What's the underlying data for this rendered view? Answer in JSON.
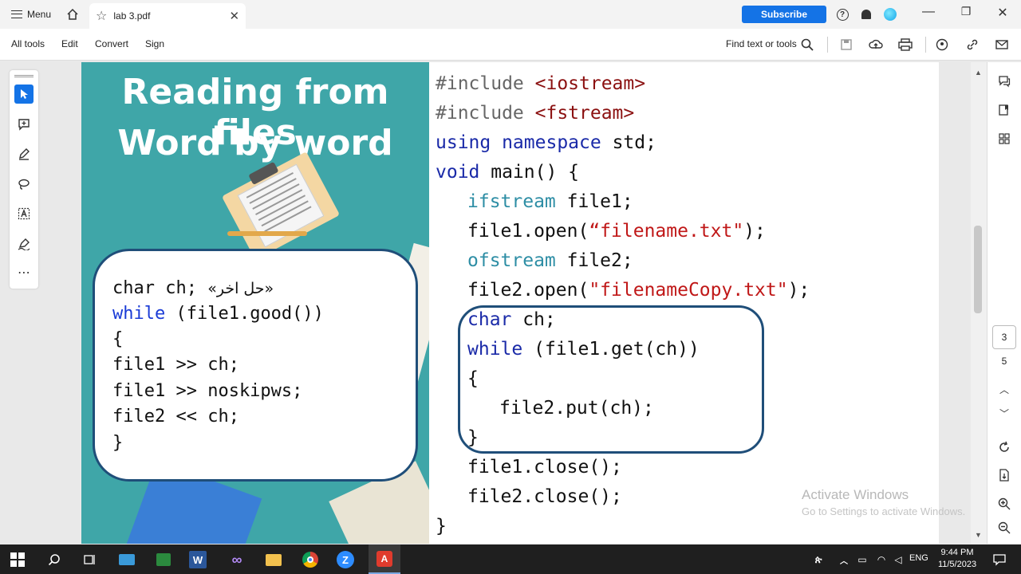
{
  "titlebar": {
    "menu_label": "Menu",
    "tab_name": "lab 3.pdf",
    "subscribe_label": "Subscribe"
  },
  "toolbar": {
    "items": [
      "All tools",
      "Edit",
      "Convert",
      "Sign"
    ],
    "find_label": "Find text or tools"
  },
  "slide": {
    "title_line1": "Reading from files",
    "title_line2": "Word by word",
    "left_code": [
      {
        "kw": "",
        "text": "char ch; ",
        "arabic": "«حل اخر»"
      },
      {
        "kw": "while",
        "text": " (file1.good())"
      },
      {
        "kw": "",
        "text": "{"
      },
      {
        "kw": "",
        "text": "file1 >> ch;"
      },
      {
        "kw": "",
        "text": "file1 >> noskipws;"
      },
      {
        "kw": "",
        "text": "file2 << ch;"
      },
      {
        "kw": "",
        "text": "}"
      }
    ],
    "right_code": [
      {
        "indent": 0,
        "parts": [
          {
            "c": "gray",
            "t": "#include "
          },
          {
            "c": "maroon",
            "t": "<iostream>"
          }
        ]
      },
      {
        "indent": 0,
        "parts": [
          {
            "c": "gray",
            "t": "#include "
          },
          {
            "c": "maroon",
            "t": "<fstream>"
          }
        ]
      },
      {
        "indent": 0,
        "parts": [
          {
            "c": "navy",
            "t": "using namespace"
          },
          {
            "c": "",
            "t": " std;"
          }
        ]
      },
      {
        "indent": 0,
        "parts": [
          {
            "c": "navy",
            "t": "void"
          },
          {
            "c": "",
            "t": " main() {"
          }
        ]
      },
      {
        "indent": 1,
        "parts": [
          {
            "c": "teal",
            "t": "ifstream"
          },
          {
            "c": "",
            "t": " file1;"
          }
        ]
      },
      {
        "indent": 1,
        "parts": [
          {
            "c": "",
            "t": "file1.open("
          },
          {
            "c": "red",
            "t": "“filename.txt\""
          },
          {
            "c": "",
            "t": ");"
          }
        ]
      },
      {
        "indent": 1,
        "parts": [
          {
            "c": "teal",
            "t": "ofstream"
          },
          {
            "c": "",
            "t": " file2;"
          }
        ]
      },
      {
        "indent": 1,
        "parts": [
          {
            "c": "",
            "t": "file2.open("
          },
          {
            "c": "red",
            "t": "\"filenameCopy.txt\""
          },
          {
            "c": "",
            "t": ");"
          }
        ]
      },
      {
        "indent": 1,
        "parts": [
          {
            "c": "navy",
            "t": "char"
          },
          {
            "c": "",
            "t": " ch;"
          }
        ]
      },
      {
        "indent": 1,
        "parts": [
          {
            "c": "navy",
            "t": "while"
          },
          {
            "c": "",
            "t": " (file1.get(ch))"
          }
        ]
      },
      {
        "indent": 1,
        "parts": [
          {
            "c": "",
            "t": "{"
          }
        ]
      },
      {
        "indent": 2,
        "parts": [
          {
            "c": "",
            "t": "file2.put(ch);"
          }
        ]
      },
      {
        "indent": 1,
        "parts": [
          {
            "c": "",
            "t": "}"
          }
        ]
      },
      {
        "indent": 1,
        "parts": [
          {
            "c": "",
            "t": "file1.close();"
          }
        ]
      },
      {
        "indent": 1,
        "parts": [
          {
            "c": "",
            "t": "file2.close();"
          }
        ]
      },
      {
        "indent": 0,
        "parts": [
          {
            "c": "",
            "t": "}"
          }
        ]
      }
    ]
  },
  "navigation": {
    "current_page": "3",
    "total_pages": "5"
  },
  "watermark": {
    "line1": "Activate Windows",
    "line2": "Go to Settings to activate Windows."
  },
  "taskbar": {
    "lang": "ENG",
    "time": "9:44 PM",
    "date": "11/5/2023"
  },
  "colors": {
    "accent": "#1473e6",
    "slide_bg": "#3fa6a8",
    "box_border": "#1f4e79"
  }
}
